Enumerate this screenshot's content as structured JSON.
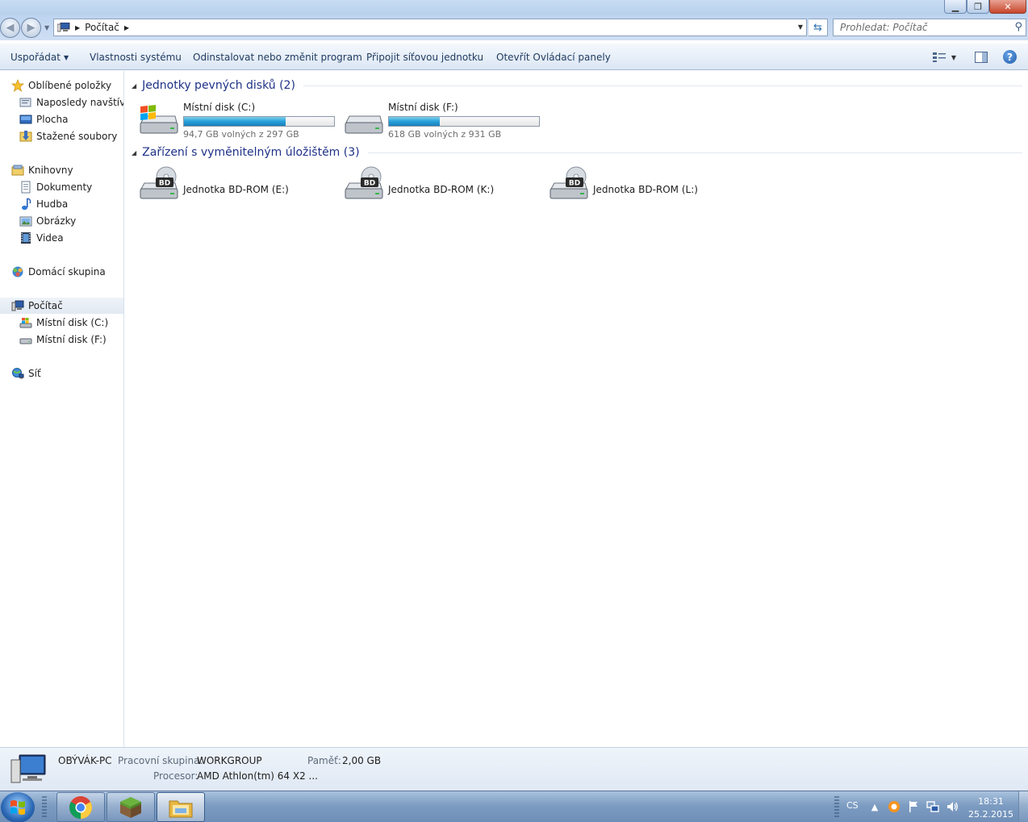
{
  "window": {
    "minimize_glyph": "▁",
    "maximize_glyph": "❐",
    "close_glyph": "✕"
  },
  "nav": {
    "back_glyph": "◀",
    "forward_glyph": "▶",
    "breadcrumb": [
      "Počítač"
    ],
    "search_placeholder": "Prohledat: Počítač"
  },
  "toolbar": {
    "organize": "Uspořádat",
    "system_properties": "Vlastnosti systému",
    "uninstall": "Odinstalovat nebo změnit program",
    "map_drive": "Připojit síťovou jednotku",
    "control_panel": "Otevřít Ovládací panely"
  },
  "sidebar": {
    "favorites": {
      "label": "Oblíbené položky",
      "items": [
        "Naposledy navštíver",
        "Plocha",
        "Stažené soubory"
      ]
    },
    "libraries": {
      "label": "Knihovny",
      "items": [
        "Dokumenty",
        "Hudba",
        "Obrázky",
        "Videa"
      ]
    },
    "homegroup": "Domácí skupina",
    "computer": {
      "label": "Počítač",
      "items": [
        "Místní disk (C:)",
        "Místní disk (F:)"
      ]
    },
    "network": "Síť"
  },
  "content": {
    "hard_drives": {
      "title": "Jednotky pevných disků (2)",
      "drives": [
        {
          "name": "Místní disk (C:)",
          "free_text": "94,7 GB volných z 297 GB",
          "used_fraction": 0.68
        },
        {
          "name": "Místní disk (F:)",
          "free_text": "618 GB volných z 931 GB",
          "used_fraction": 0.34
        }
      ]
    },
    "removable": {
      "title": "Zařízení s vyměnitelným úložištěm (3)",
      "drives": [
        {
          "name": "Jednotka BD-ROM (E:)",
          "badge": "BD"
        },
        {
          "name": "Jednotka BD-ROM (K:)",
          "badge": "BD"
        },
        {
          "name": "Jednotka BD-ROM (L:)",
          "badge": "BD"
        }
      ]
    }
  },
  "details": {
    "computer_name": "OBÝVÁK-PC",
    "workgroup_label": "Pracovní skupina:",
    "workgroup_value": "WORKGROUP",
    "memory_label": "Paměť:",
    "memory_value": "2,00 GB",
    "processor_label": "Procesor:",
    "processor_value": "AMD Athlon(tm) 64 X2 ..."
  },
  "taskbar": {
    "language": "CS",
    "time": "18:31",
    "date": "25.2.2015"
  },
  "colors": {
    "link_blue": "#1e3287",
    "usage_bar": "#26a0da"
  }
}
